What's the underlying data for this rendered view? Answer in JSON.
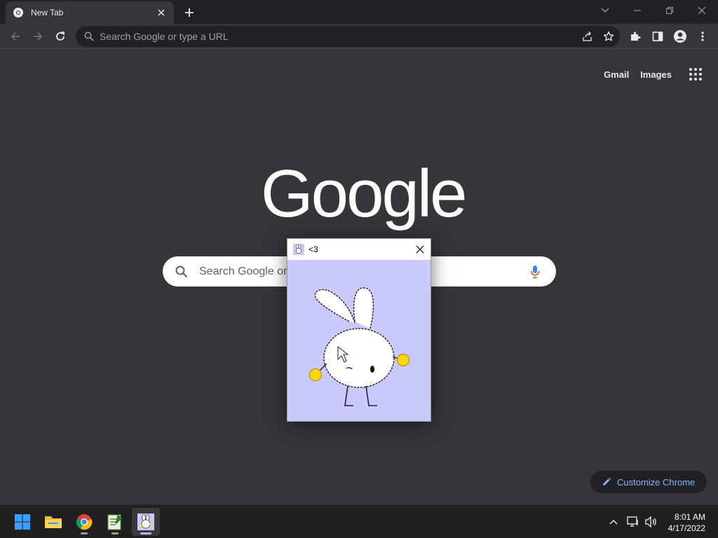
{
  "browser": {
    "tab": {
      "title": "New Tab"
    },
    "omnibox": {
      "placeholder": "Search Google or type a URL"
    }
  },
  "newtab_page": {
    "links": {
      "gmail": "Gmail",
      "images": "Images"
    },
    "logo_text": "Google",
    "search": {
      "placeholder": "Search Google or"
    },
    "customize_label": "Customize Chrome"
  },
  "popup": {
    "title": "<3"
  },
  "taskbar": {
    "apps": [
      "windows-start",
      "file-explorer",
      "chrome",
      "notepad-editor",
      "bunny-app"
    ],
    "clock": {
      "time": "8:01 AM",
      "date": "4/17/2022"
    }
  },
  "colors": {
    "bg": "#35363a",
    "tabstrip": "#202124",
    "accent_link": "#8ab4f8",
    "popup_canvas": "#c9c9fb"
  }
}
